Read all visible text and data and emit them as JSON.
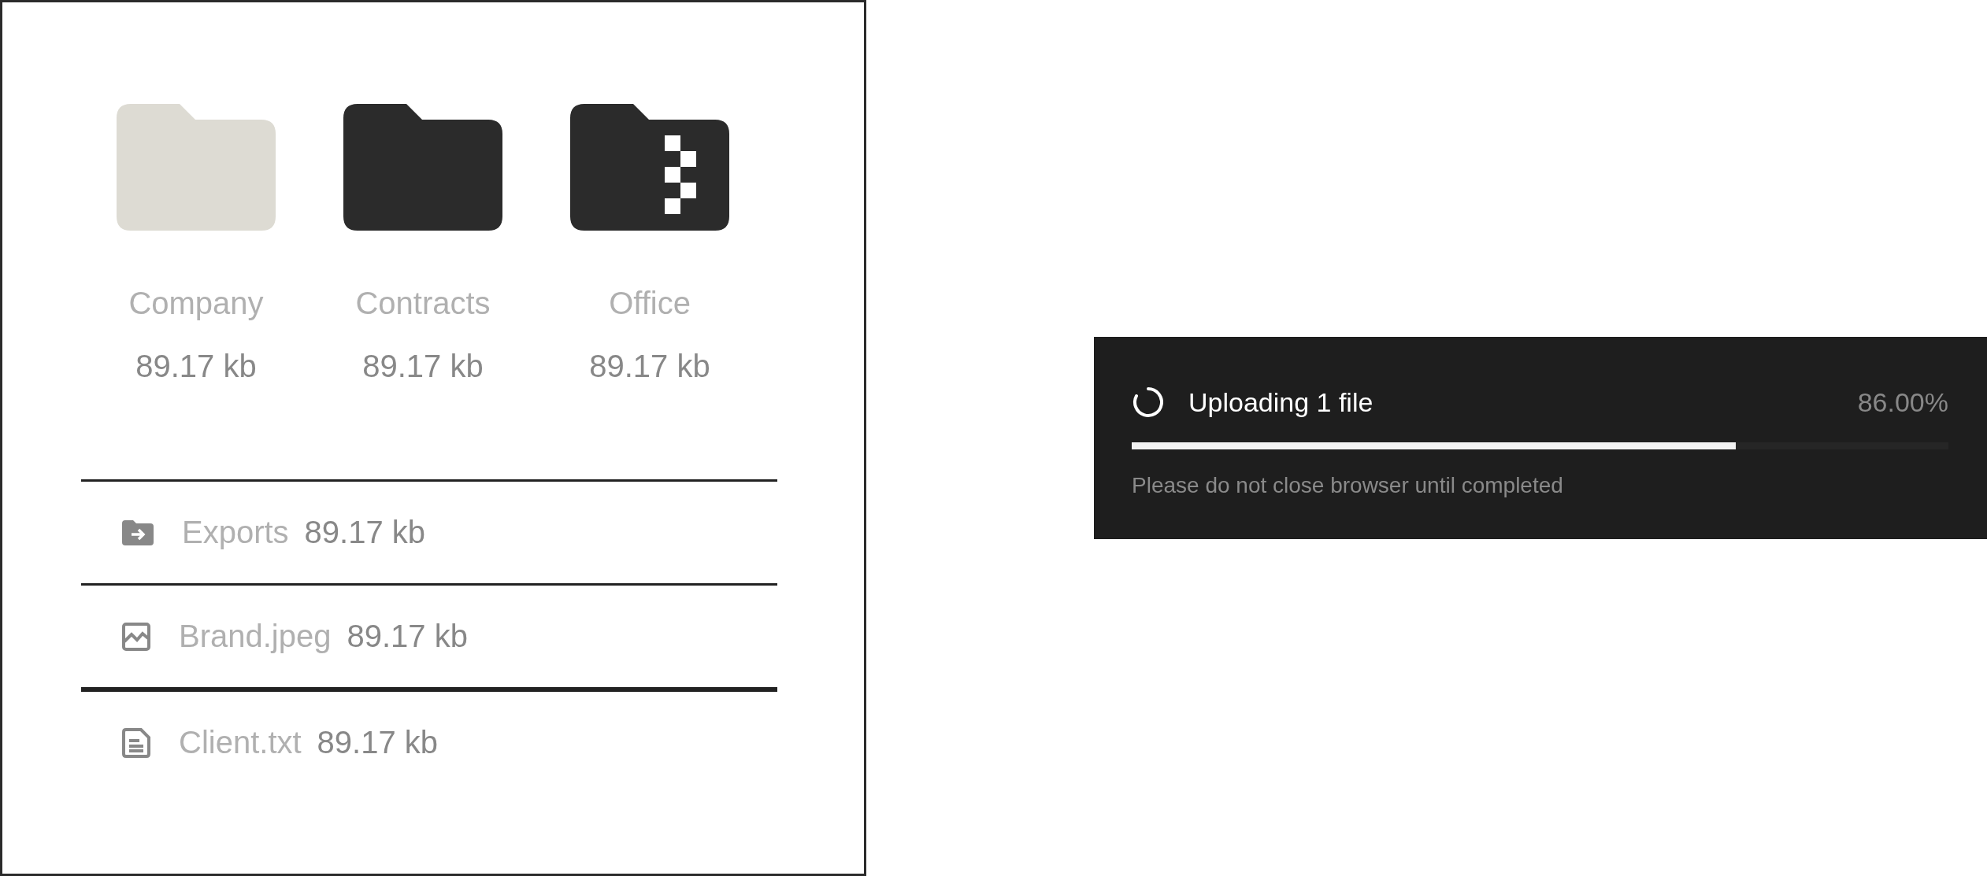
{
  "folders": [
    {
      "kind": "light",
      "name": "Company",
      "size": "89.17 kb"
    },
    {
      "kind": "dark",
      "name": "Contracts",
      "size": "89.17 kb"
    },
    {
      "kind": "zip",
      "name": "Office",
      "size": "89.17 kb"
    }
  ],
  "files": [
    {
      "kind": "folder",
      "name": "Exports",
      "size": "89.17 kb"
    },
    {
      "kind": "image",
      "name": "Brand.jpeg",
      "size": "89.17 kb"
    },
    {
      "kind": "text",
      "name": "Client.txt",
      "size": "89.17 kb"
    }
  ],
  "upload": {
    "title": "Uploading 1 file",
    "percent": "86.00%",
    "level": 0.74,
    "note": "Please do not close browser until completed"
  }
}
